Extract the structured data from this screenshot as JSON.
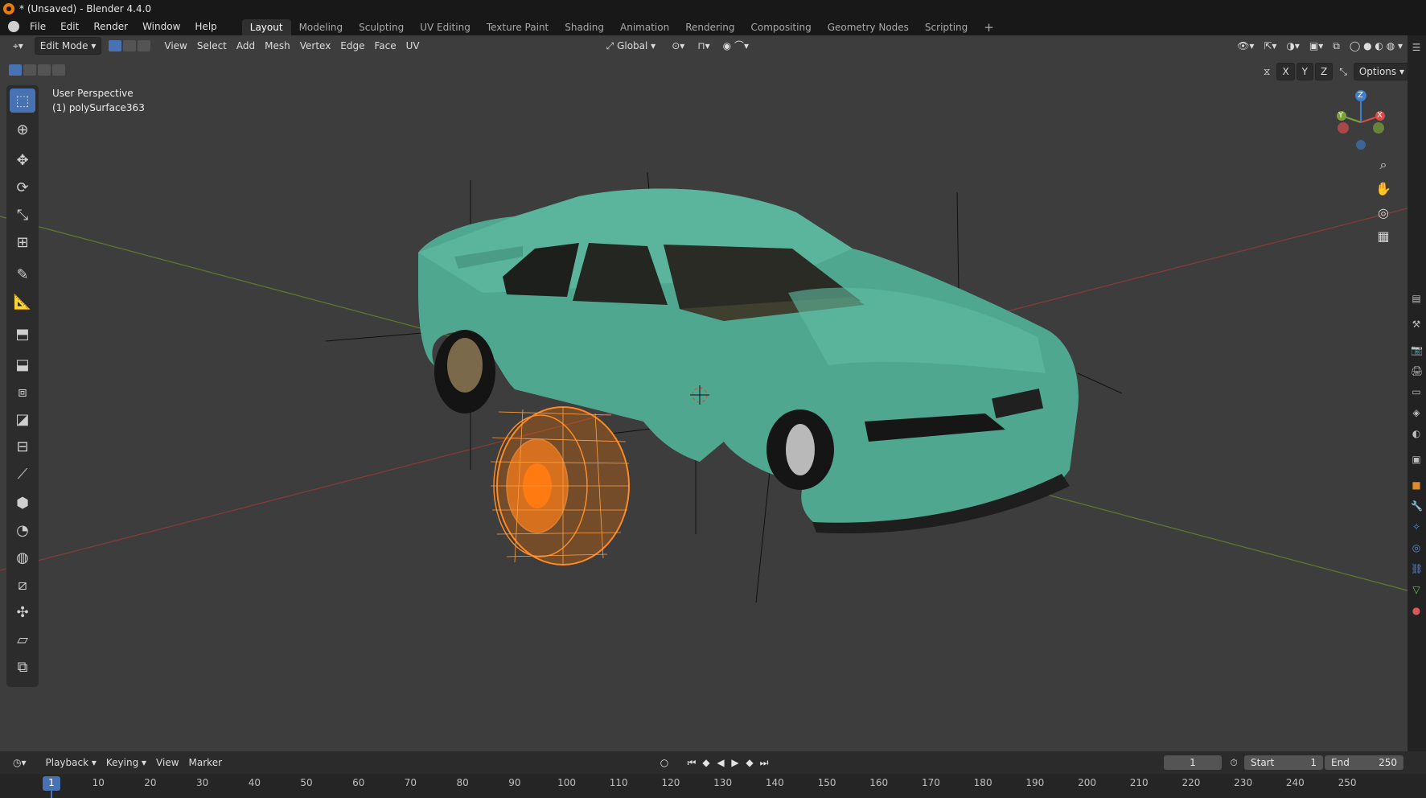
{
  "title_bar": {
    "title": "* (Unsaved) - Blender 4.4.0"
  },
  "menu": {
    "items": [
      "File",
      "Edit",
      "Render",
      "Window",
      "Help"
    ],
    "workspace_tabs": [
      "Layout",
      "Modeling",
      "Sculpting",
      "UV Editing",
      "Texture Paint",
      "Shading",
      "Animation",
      "Rendering",
      "Compositing",
      "Geometry Nodes",
      "Scripting"
    ],
    "active_tab": "Layout",
    "add_tab": "+"
  },
  "viewport_header": {
    "mode": "Edit Mode",
    "menus": [
      "View",
      "Select",
      "Add",
      "Mesh",
      "Vertex",
      "Edge",
      "Face",
      "UV"
    ],
    "orientation": "Global",
    "options_label": "Options",
    "axes": [
      "X",
      "Y",
      "Z"
    ]
  },
  "viewport": {
    "view_name": "User Perspective",
    "object_name": "(1) polySurface363",
    "gizmo": {
      "z": "Z",
      "y": "Y",
      "x": "X"
    }
  },
  "timeline": {
    "menus": [
      "Playback",
      "Keying",
      "View",
      "Marker"
    ],
    "current_frame": "1",
    "start_label": "Start",
    "start_value": "1",
    "end_label": "End",
    "end_value": "250",
    "ruler_ticks": [
      "1",
      "10",
      "20",
      "30",
      "40",
      "50",
      "60",
      "70",
      "80",
      "90",
      "100",
      "110",
      "120",
      "130",
      "140",
      "150",
      "160",
      "170",
      "180",
      "190",
      "200",
      "210",
      "220",
      "230",
      "240",
      "250"
    ]
  },
  "colors": {
    "accent": "#4772b3",
    "car_body": "#4fa78f",
    "wheel_selected": "#ff7f1a",
    "x_axis": "#8c3a3a",
    "y_axis": "#5b7a2a"
  }
}
